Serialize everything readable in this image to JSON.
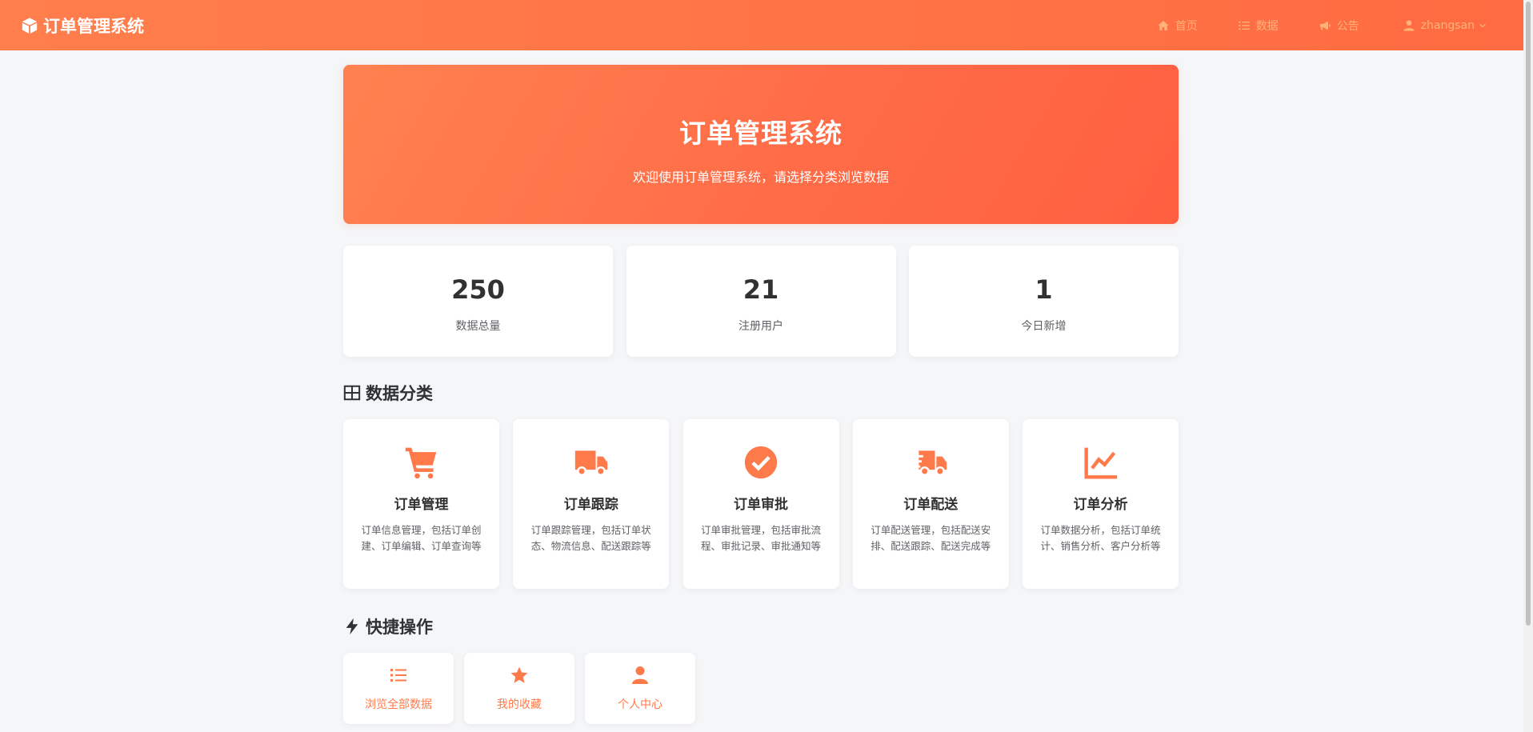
{
  "navbar": {
    "brand": "订单管理系统",
    "brand_icon": "cube-icon",
    "links": [
      {
        "label": "首页",
        "icon": "home-icon"
      },
      {
        "label": "数据",
        "icon": "list-icon"
      },
      {
        "label": "公告",
        "icon": "megaphone-icon"
      }
    ],
    "user": {
      "label": "zhangsan",
      "icon": "user-icon"
    }
  },
  "hero": {
    "title": "订单管理系统",
    "subtitle": "欢迎使用订单管理系统，请选择分类浏览数据"
  },
  "stats": [
    {
      "value": "250",
      "label": "数据总量"
    },
    {
      "value": "21",
      "label": "注册用户"
    },
    {
      "value": "1",
      "label": "今日新增"
    }
  ],
  "categories_section": {
    "title": "数据分类",
    "items": [
      {
        "title": "订单管理",
        "desc": "订单信息管理，包括订单创建、订单编辑、订单查询等",
        "icon": "cart-icon"
      },
      {
        "title": "订单跟踪",
        "desc": "订单跟踪管理，包括订单状态、物流信息、配送跟踪等",
        "icon": "truck-icon"
      },
      {
        "title": "订单审批",
        "desc": "订单审批管理，包括审批流程、审批记录、审批通知等",
        "icon": "check-circle-icon"
      },
      {
        "title": "订单配送",
        "desc": "订单配送管理，包括配送安排、配送跟踪、配送完成等",
        "icon": "fast-truck-icon"
      },
      {
        "title": "订单分析",
        "desc": "订单数据分析，包括订单统计、销售分析、客户分析等",
        "icon": "line-chart-icon"
      }
    ]
  },
  "quick_section": {
    "title": "快捷操作",
    "items": [
      {
        "label": "浏览全部数据",
        "icon": "list-icon"
      },
      {
        "label": "我的收藏",
        "icon": "star-icon"
      },
      {
        "label": "个人中心",
        "icon": "user-icon"
      }
    ]
  },
  "colors": {
    "accent": "#ff7a4a",
    "navbar_start": "#ff7e4c",
    "navbar_end": "#ff6b42",
    "background": "#f5f6f8"
  }
}
